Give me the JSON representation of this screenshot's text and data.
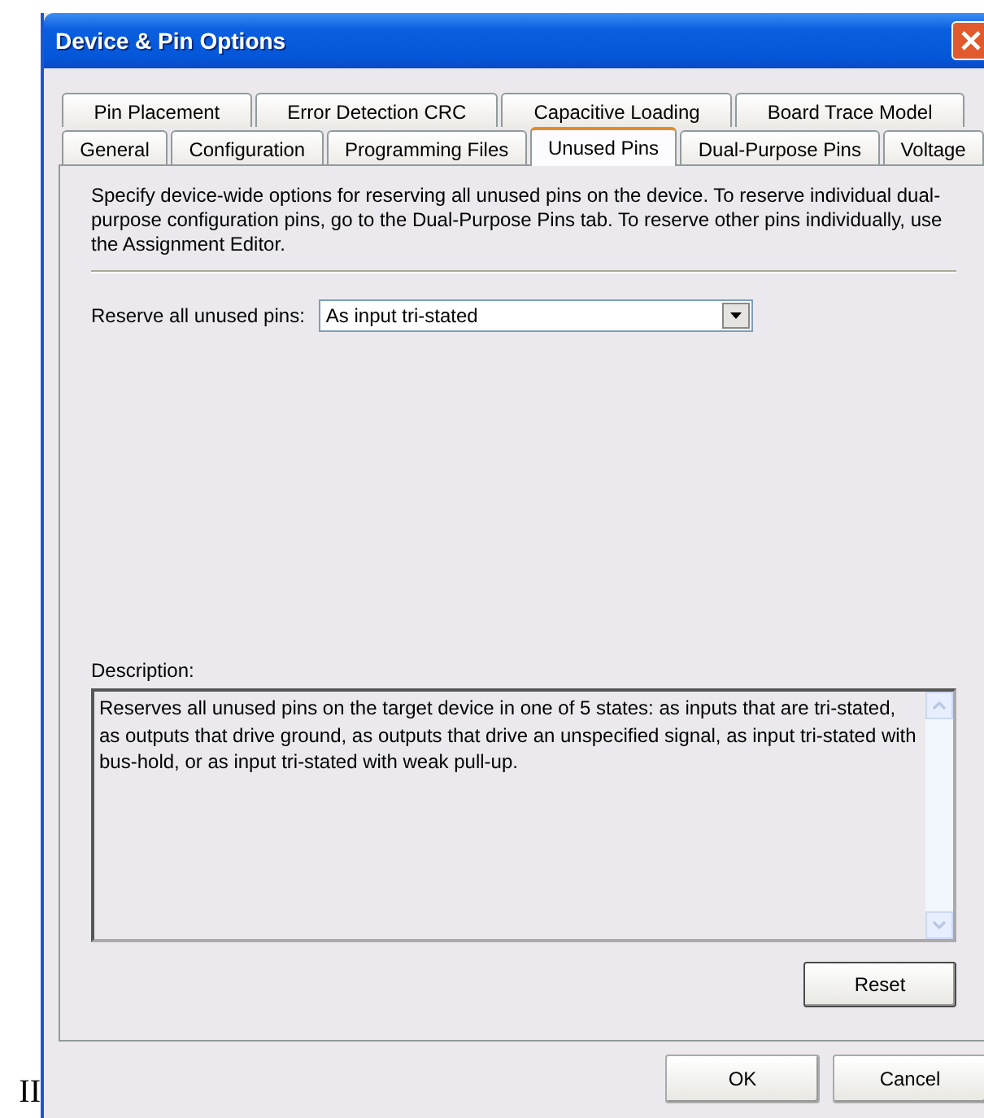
{
  "margin_text": "II",
  "window": {
    "title": "Device & Pin Options"
  },
  "tab_rows": [
    [
      {
        "label": "Pin Placement",
        "selected": false
      },
      {
        "label": "Error Detection CRC",
        "selected": false
      },
      {
        "label": "Capacitive Loading",
        "selected": false
      },
      {
        "label": "Board Trace Model",
        "selected": false
      }
    ],
    [
      {
        "label": "General",
        "selected": false
      },
      {
        "label": "Configuration",
        "selected": false
      },
      {
        "label": "Programming Files",
        "selected": false
      },
      {
        "label": "Unused Pins",
        "selected": true
      },
      {
        "label": "Dual-Purpose Pins",
        "selected": false
      },
      {
        "label": "Voltage",
        "selected": false
      }
    ]
  ],
  "intro": "Specify device-wide options for reserving all unused pins on the device. To reserve individual dual-purpose configuration pins, go to the Dual-Purpose Pins tab. To reserve other pins individually, use the Assignment Editor.",
  "reserve": {
    "label": "Reserve all unused pins:",
    "value": "As input tri-stated"
  },
  "description": {
    "label": "Description:",
    "text": "Reserves all unused pins on the target device in one of 5 states: as inputs that are tri-stated, as outputs that drive ground, as outputs that drive an unspecified signal, as input tri-stated with bus-hold, or as input tri-stated with weak pull-up."
  },
  "panel_buttons": [
    "Reset"
  ],
  "buttons": [
    "OK",
    "Cancel"
  ]
}
